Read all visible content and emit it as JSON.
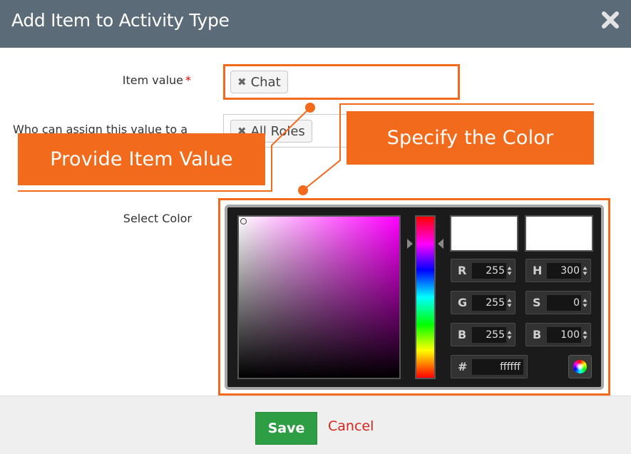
{
  "dialog": {
    "title": "Add Item to Activity Type"
  },
  "form": {
    "item_value_label": "Item value",
    "required_marker": "*",
    "item_value_chip": "Chat",
    "who_label": "Who can assign this value to a",
    "who_chip": "All Roles",
    "select_color_label": "Select Color",
    "chip_remove_glyph": "✖"
  },
  "callouts": {
    "provide": "Provide Item Value",
    "specify": "Specify the Color"
  },
  "color_picker": {
    "hue_color": "#ff00ff",
    "new_color": "#ffffff",
    "current_color": "#ffffff",
    "r_label": "R",
    "r_value": "255",
    "g_label": "G",
    "g_value": "255",
    "b_label": "B",
    "b_value": "255",
    "h_label": "H",
    "h_value": "300",
    "s_label": "S",
    "s_value": "0",
    "br_label": "B",
    "br_value": "100",
    "hex_label": "#",
    "hex_value": "ffffff"
  },
  "footer": {
    "save_label": "Save",
    "cancel_label": "Cancel"
  },
  "colors": {
    "header": "#5b6b78",
    "accent_orange": "#f26a1b",
    "save_green": "#2e9e44",
    "cancel_red": "#d9241b"
  },
  "icons": {
    "close": "close-icon",
    "chip_remove": "remove-icon",
    "spinner": "spinner-arrows-icon",
    "color_wheel": "color-wheel-icon"
  }
}
